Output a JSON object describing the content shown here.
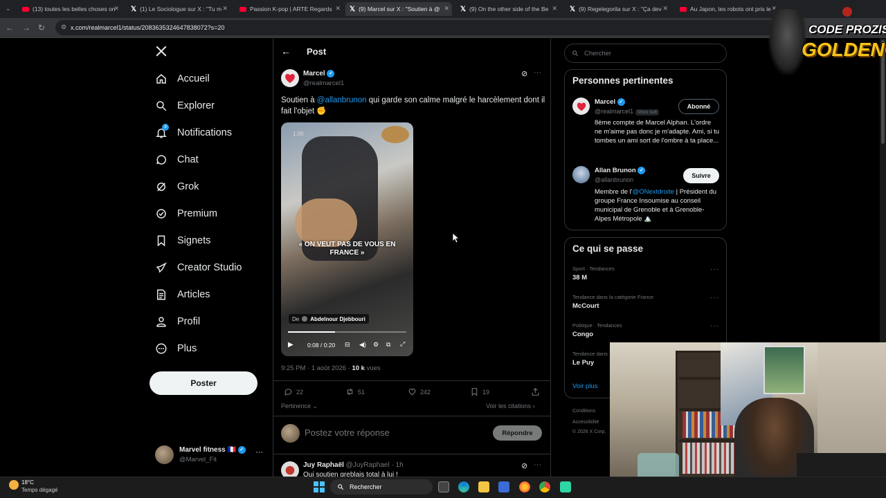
{
  "browser": {
    "tabs": [
      {
        "label": "(13) toutes les belles choses on",
        "icon": "youtube"
      },
      {
        "label": "(1) Le Sociologue sur X : \"Tu m",
        "icon": "x"
      },
      {
        "label": "Passion K-pop | ARTE Regards",
        "icon": "youtube"
      },
      {
        "label": "(9) Marcel sur X : \"Soutien à @",
        "icon": "x"
      },
      {
        "label": "(9) On the other side of the Be",
        "icon": "x"
      },
      {
        "label": "(9) Regelegorila sur X : \"Ça dev",
        "icon": "x"
      },
      {
        "label": "Au Japon, les robots ont pris le",
        "icon": "youtube"
      }
    ],
    "url": "x.com/realmarcel1/status/2083635324647838072?s=20"
  },
  "nav": {
    "items": [
      {
        "label": "Accueil",
        "icon": "home-icon"
      },
      {
        "label": "Explorer",
        "icon": "search-icon"
      },
      {
        "label": "Notifications",
        "icon": "bell-icon",
        "badge": "9"
      },
      {
        "label": "Chat",
        "icon": "chat-icon"
      },
      {
        "label": "Grok",
        "icon": "grok-icon"
      },
      {
        "label": "Premium",
        "icon": "premium-icon"
      },
      {
        "label": "Signets",
        "icon": "bookmark-icon"
      },
      {
        "label": "Creator Studio",
        "icon": "rocket-icon"
      },
      {
        "label": "Articles",
        "icon": "article-icon"
      },
      {
        "label": "Profil",
        "icon": "profile-icon"
      },
      {
        "label": "Plus",
        "icon": "more-icon"
      }
    ],
    "post_button": "Poster",
    "account": {
      "name": "Marvel fitness 🇫🇷",
      "handle": "@Marvel_Fit"
    }
  },
  "post": {
    "header": "Post",
    "author": {
      "name": "Marcel",
      "handle": "@realmarcel1"
    },
    "text_prefix": "Soutien à ",
    "mention": "@allanbrunon",
    "text_suffix": " qui garde son calme malgré le harcèlement dont il fait l'objet ✊",
    "video": {
      "speed": "1.00",
      "caption": "« ON VEUT PAS DE VOUS EN FRANCE »",
      "from_label": "De",
      "from_name": "Abdelnour Djebbouri",
      "time": "0:08 / 0:20",
      "progress": 0.4
    },
    "timestamp": "9:25 PM · 1 août 2026 · ",
    "views_count": "10 k",
    "views_label": " vues",
    "actions": {
      "replies": "22",
      "reposts": "51",
      "likes": "242",
      "bookmarks": "19"
    },
    "sort_label": "Pertinence",
    "quotes_label": "Voir les citations",
    "reply_placeholder": "Postez votre réponse",
    "reply_button": "Répondre"
  },
  "reply": {
    "name": "Juy Raphaël",
    "handle": "@JuyRaphael · 1h",
    "text": "Qui soutien gre​blais total à lui !"
  },
  "sidebar": {
    "search_placeholder": "Chercher",
    "relevant_title": "Personnes pertinentes",
    "people": [
      {
        "name": "Marcel",
        "handle": "@realmarcel1",
        "follows_you": "Vous suit",
        "button": "Abonné",
        "bio": "8ème compte de Marcel Alphan. L'ordre ne m'aime pas donc je m'adapte. Ami, si tu tombes un ami sort de l'ombre à ta place..."
      },
      {
        "name": "Allan Brunon",
        "handle": "@allanbrunon",
        "button": "Suivre",
        "bio_prefix": "Membre de l'",
        "bio_mention": "@ONextdroite",
        "bio_suffix": " | Président du groupe France Insoumise au conseil municipal de Grenoble et à Grenoble-Alpes Métropole 🏔️"
      }
    ],
    "trends_title": "Ce qui se passe",
    "trends": [
      {
        "label": "Sport · Tendances",
        "name": "38 M"
      },
      {
        "label": "Tendance dans la catégorie France",
        "name": "McCourt"
      },
      {
        "label": "Politique · Tendances",
        "name": "Congo"
      },
      {
        "label": "Tendance dans",
        "name": "Le Puy"
      }
    ],
    "see_more": "Voir plus",
    "footer": [
      "Conditions",
      "Accessibilité",
      "© 2026 X Corp."
    ]
  },
  "taskbar": {
    "temperature": "18°C",
    "weather": "Temps dégagé",
    "search": "Rechercher"
  },
  "overlay": {
    "logo_line1": "CODE PROZIS",
    "logo_line2": "GOLDENG"
  }
}
